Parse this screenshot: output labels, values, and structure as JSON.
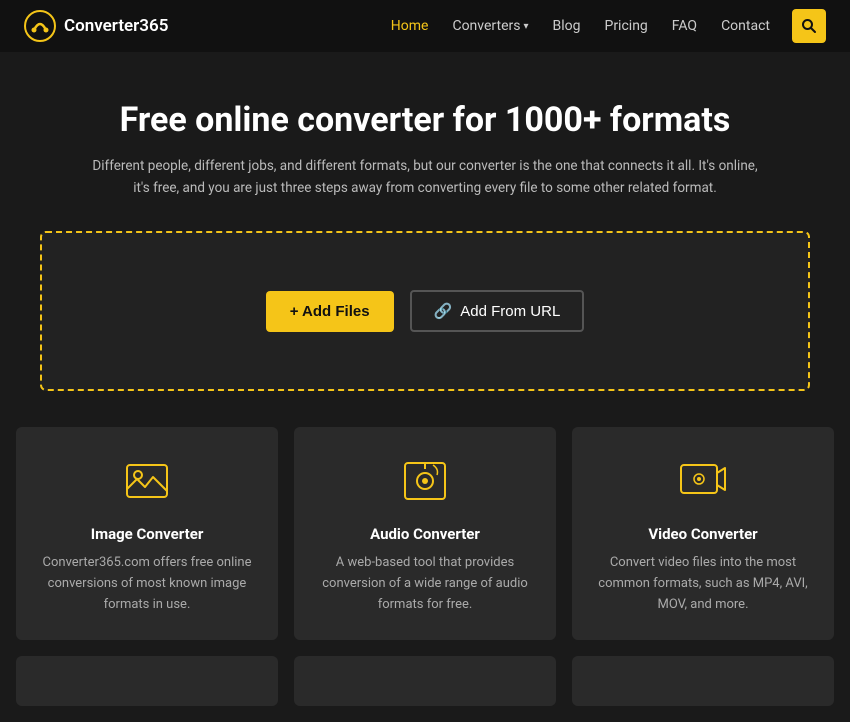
{
  "header": {
    "logo_text": "Converter365",
    "nav": [
      {
        "label": "Home",
        "active": true,
        "id": "home"
      },
      {
        "label": "Converters",
        "active": false,
        "id": "converters",
        "has_dropdown": true
      },
      {
        "label": "Blog",
        "active": false,
        "id": "blog"
      },
      {
        "label": "Pricing",
        "active": false,
        "id": "pricing"
      },
      {
        "label": "FAQ",
        "active": false,
        "id": "faq"
      },
      {
        "label": "Contact",
        "active": false,
        "id": "contact"
      }
    ],
    "search_label": "search"
  },
  "hero": {
    "title": "Free online converter for 1000+ formats",
    "subtitle": "Different people, different jobs, and different formats, but our converter is the one that connects it all. It's online, it's free, and you are just three steps away from converting every file to some other related format."
  },
  "upload": {
    "add_files_label": "+ Add Files",
    "add_url_label": "🔗 Add From URL"
  },
  "cards": [
    {
      "id": "image",
      "title": "Image Converter",
      "desc": "Converter365.com offers free online conversions of most known image formats in use.",
      "icon": "image"
    },
    {
      "id": "audio",
      "title": "Audio Converter",
      "desc": "A web-based tool that provides conversion of a wide range of audio formats for free.",
      "icon": "audio"
    },
    {
      "id": "video",
      "title": "Video Converter",
      "desc": "Convert video files into the most common formats, such as MP4, AVI, MOV, and more.",
      "icon": "video"
    }
  ],
  "colors": {
    "accent": "#f5c518",
    "bg_dark": "#111111",
    "bg_card": "#2a2a2a"
  }
}
